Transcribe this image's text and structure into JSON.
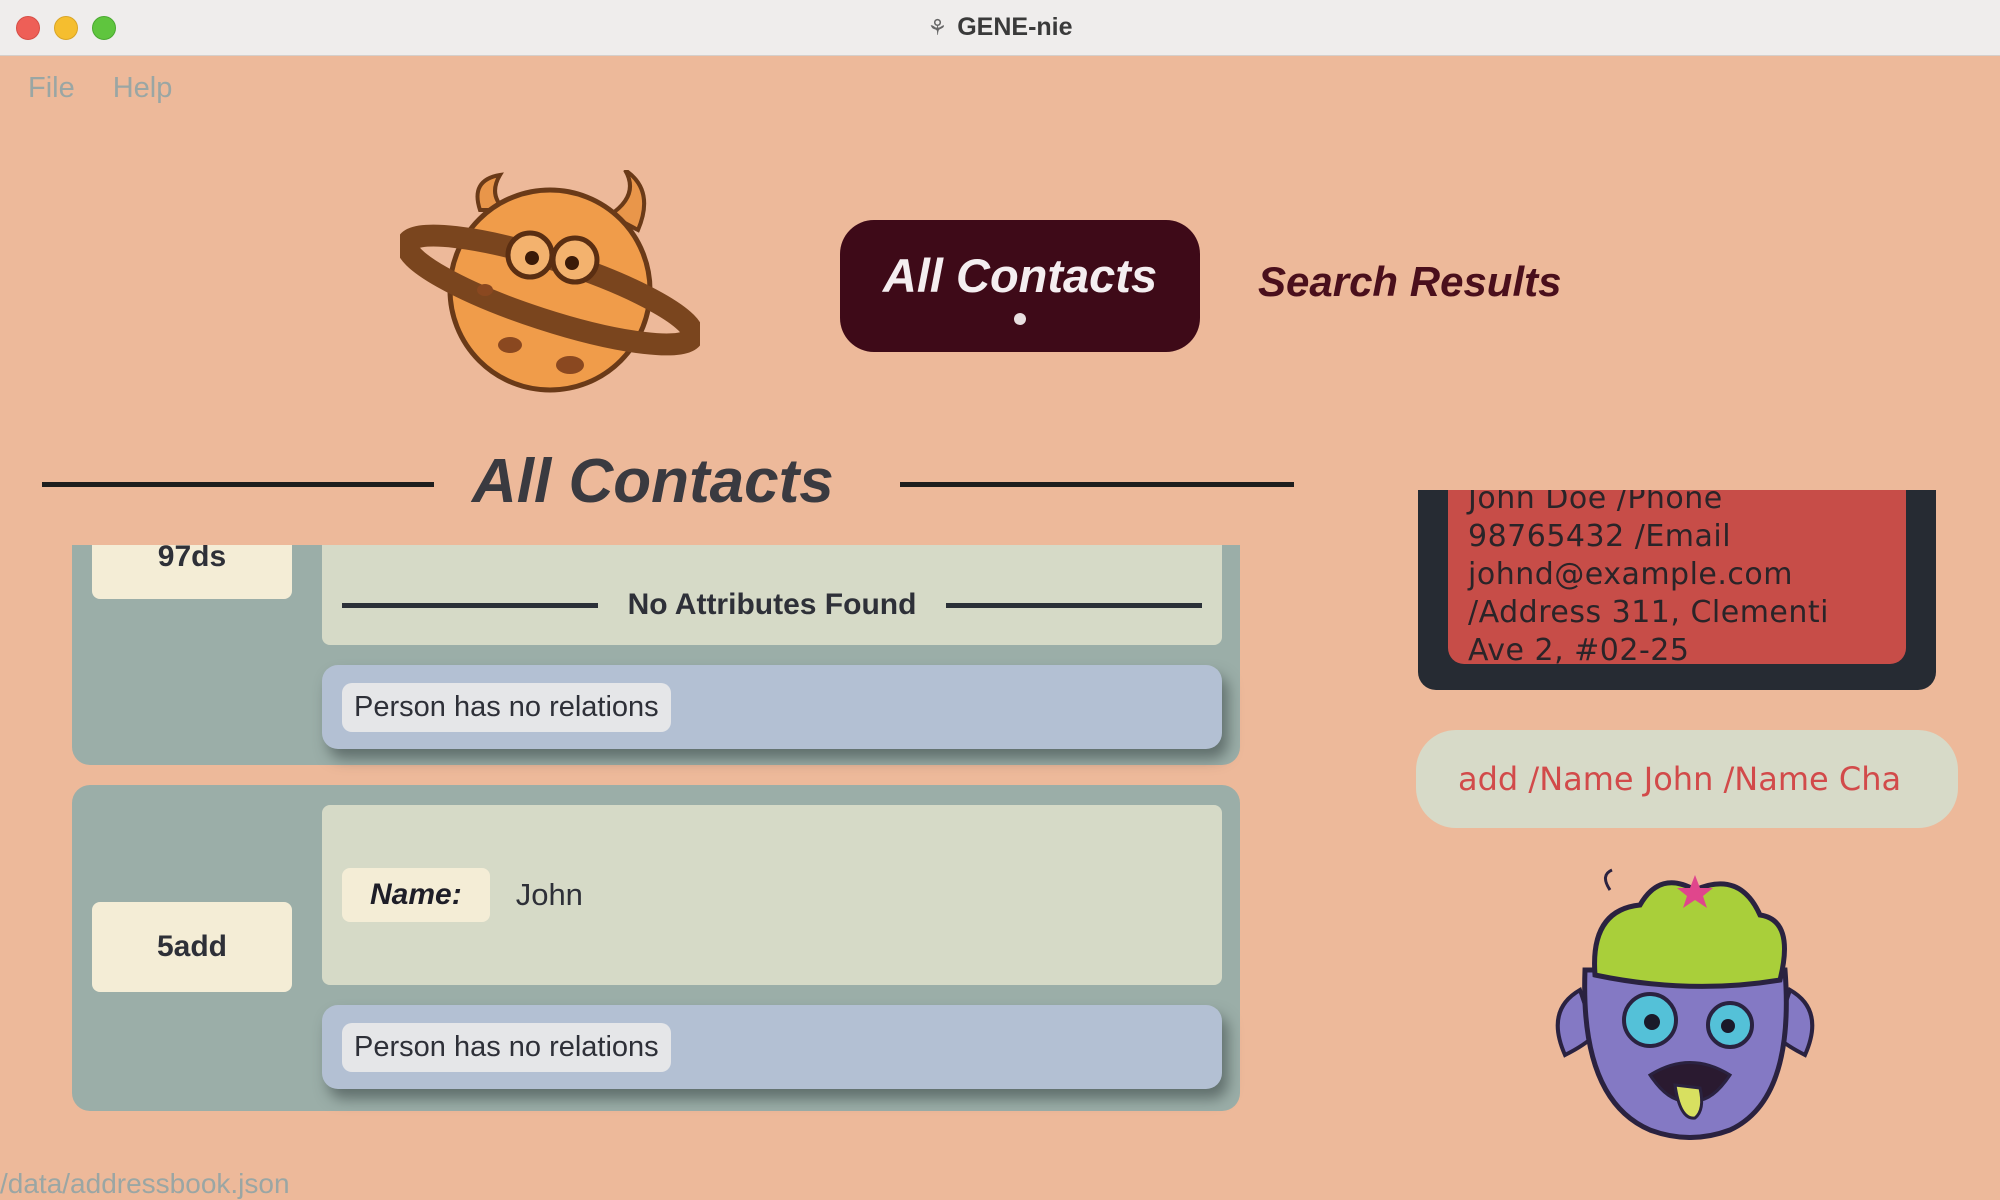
{
  "window": {
    "title": "GENE-nie"
  },
  "menu": {
    "items": [
      {
        "label": "File"
      },
      {
        "label": "Help"
      }
    ]
  },
  "tabs": {
    "active": "All Contacts",
    "inactive": "Search Results"
  },
  "section": {
    "title": "All Contacts"
  },
  "contacts": [
    {
      "index": "97ds",
      "attributes_text": "No Attributes Found",
      "relations_text": "Person has no relations"
    },
    {
      "index": "5add",
      "name_key": "Name:",
      "name_value": "John",
      "relations_text": "Person has no relations"
    }
  ],
  "result_display": {
    "lines": [
      "John Doe /Phone",
      "98765432 /Email",
      "johnd@example.com",
      "/Address 311, Clementi",
      "Ave 2, #02-25"
    ]
  },
  "command_box": {
    "value": "add /Name John /Name Cha"
  },
  "status": {
    "path": "/data/addressbook.json"
  },
  "colors": {
    "background": "#EDB99A",
    "active_tab": "#3E0A18",
    "card": "#9BAEA8",
    "result_bg": "#C74D48",
    "command_text": "#D24A4A"
  },
  "icons": {
    "logo": "planet-cookie-monster-icon",
    "mascot": "zombie-404-icon",
    "app": "genie-lamp-icon"
  }
}
